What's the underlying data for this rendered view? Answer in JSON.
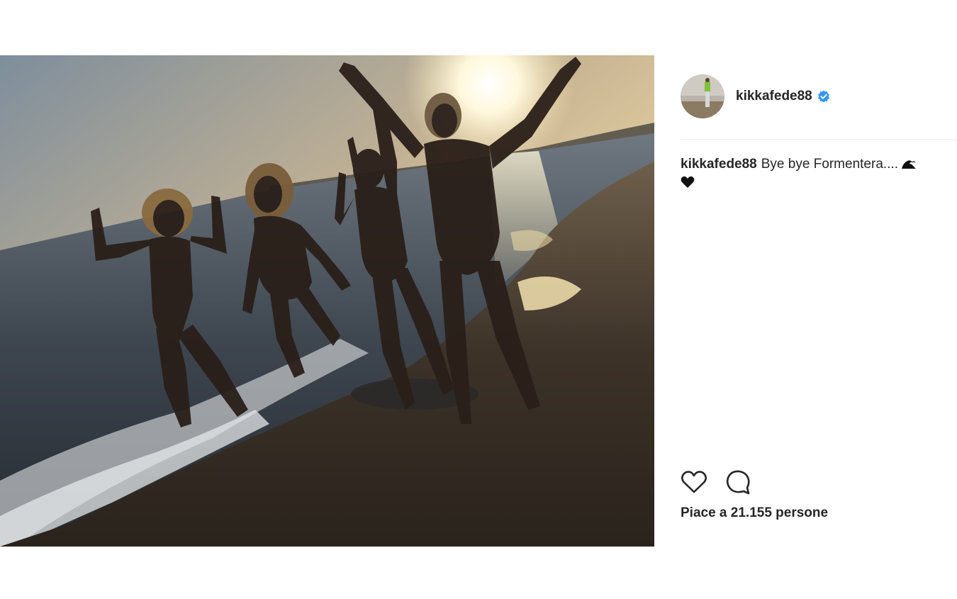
{
  "post": {
    "username": "kikkafede88",
    "verified": true,
    "caption": {
      "username": "kikkafede88",
      "text": "Bye bye Formentera....",
      "emoji_icons": [
        "wave-icon",
        "black-heart-icon"
      ]
    },
    "likes_text": "Piace a 21.155 persone",
    "actions": [
      "like-heart-icon",
      "comment-bubble-icon"
    ]
  },
  "colors": {
    "text": "#262626",
    "verified_badge": "#3897f0",
    "divider": "#efefef"
  }
}
